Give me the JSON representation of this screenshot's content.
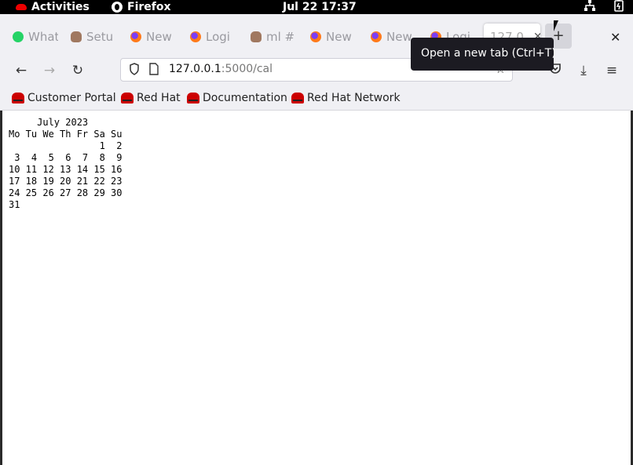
{
  "topbar": {
    "activities": "Activities",
    "app": "Firefox",
    "clock": "Jul 22  17:37"
  },
  "tabs": [
    {
      "label": "What",
      "icon": "whatsapp-icon"
    },
    {
      "label": "Setu",
      "icon": "person-icon"
    },
    {
      "label": "New",
      "icon": "firefox-icon"
    },
    {
      "label": "Logi",
      "icon": "firefox-icon"
    },
    {
      "label": "ml #",
      "icon": "person-icon"
    },
    {
      "label": "New",
      "icon": "firefox-icon"
    },
    {
      "label": "New",
      "icon": "firefox-icon"
    },
    {
      "label": "Logi",
      "icon": "firefox-icon"
    },
    {
      "label": "127.0",
      "icon": "none",
      "active": true
    }
  ],
  "tooltip": "Open a new tab (Ctrl+T)",
  "url": {
    "host": "127.0.0.1",
    "path": ":5000/cal"
  },
  "bookmarks": [
    {
      "label": "Customer Portal"
    },
    {
      "label": "Red Hat"
    },
    {
      "label": "Documentation"
    },
    {
      "label": "Red Hat Network"
    }
  ],
  "calendar": {
    "title": "     July 2023",
    "header": "Mo Tu We Th Fr Sa Su",
    "weeks": [
      "                1  2",
      " 3  4  5  6  7  8  9",
      "10 11 12 13 14 15 16",
      "17 18 19 20 21 22 23",
      "24 25 26 27 28 29 30",
      "31"
    ]
  }
}
